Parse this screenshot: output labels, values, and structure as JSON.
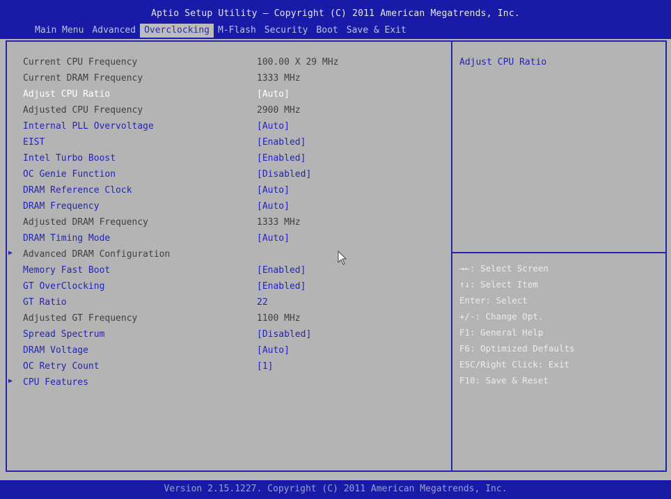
{
  "header": {
    "title": "Aptio Setup Utility – Copyright (C) 2011 American Megatrends, Inc.",
    "tabs": [
      "Main Menu",
      "Advanced",
      "Overclocking",
      "M-Flash",
      "Security",
      "Boot",
      "Save & Exit"
    ],
    "active_tab": "Overclocking"
  },
  "settings": [
    {
      "label": "Current CPU Frequency",
      "value": "100.00 X 29 MHz"
    },
    {
      "label": "Current DRAM Frequency",
      "value": "1333 MHz"
    },
    {
      "label": "Adjust CPU Ratio",
      "value": "[Auto]"
    },
    {
      "label": "Adjusted CPU Frequency",
      "value": "2900 MHz"
    },
    {
      "label": "Internal PLL Overvoltage",
      "value": "[Auto]"
    },
    {
      "label": "EIST",
      "value": "[Enabled]"
    },
    {
      "label": "Intel Turbo Boost",
      "value": "[Enabled]"
    },
    {
      "label": "OC Genie Function",
      "value": "[Disabled]"
    },
    {
      "label": "DRAM Reference Clock",
      "value": "[Auto]"
    },
    {
      "label": "DRAM Frequency",
      "value": "[Auto]"
    },
    {
      "label": "Adjusted DRAM Frequency",
      "value": "1333 MHz"
    },
    {
      "label": "DRAM Timing Mode",
      "value": "[Auto]"
    },
    {
      "label": "Advanced DRAM Configuration",
      "value": ""
    },
    {
      "label": "Memory Fast Boot",
      "value": "[Enabled]"
    },
    {
      "label": "GT OverClocking",
      "value": "[Enabled]"
    },
    {
      "label": "GT Ratio",
      "value": "22"
    },
    {
      "label": "Adjusted GT Frequency",
      "value": "1100 MHz"
    },
    {
      "label": "Spread Spectrum",
      "value": "[Disabled]"
    },
    {
      "label": "DRAM Voltage",
      "value": "[Auto]"
    },
    {
      "label": "OC Retry Count",
      "value": "[1]"
    },
    {
      "label": "CPU Features",
      "value": ""
    }
  ],
  "help": {
    "title": "Adjust CPU Ratio",
    "keys": [
      "→←: Select Screen",
      "↑↓: Select Item",
      "Enter: Select",
      "+/-: Change Opt.",
      "F1: General Help",
      "F6: Optimized Defaults",
      "ESC/Right Click: Exit",
      "F10: Save & Reset"
    ]
  },
  "footer": "Version 2.15.1227. Copyright (C) 2011 American Megatrends, Inc."
}
